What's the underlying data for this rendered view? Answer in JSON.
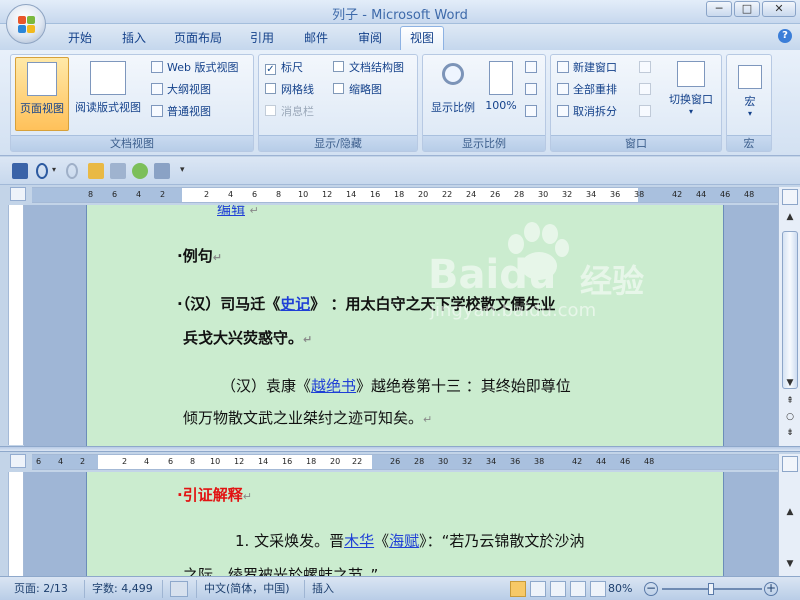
{
  "window": {
    "title": "列子 - Microsoft Word"
  },
  "tabs": [
    "开始",
    "插入",
    "页面布局",
    "引用",
    "邮件",
    "审阅",
    "视图"
  ],
  "active_tab": "视图",
  "ribbon": {
    "doc_views": {
      "label": "文档视图",
      "page_view": "页面视图",
      "reading_view": "阅读版式视图",
      "web_view": "Web 版式视图",
      "outline": "大纲视图",
      "draft": "普通视图"
    },
    "show_hide": {
      "label": "显示/隐藏",
      "ruler": "标尺",
      "doc_map": "文档结构图",
      "gridlines": "网格线",
      "thumbnails": "缩略图",
      "message_bar": "消息栏"
    },
    "zoom": {
      "label": "显示比例",
      "zoom": "显示比例",
      "hundred": "100%"
    },
    "window": {
      "label": "窗口",
      "new_window": "新建窗口",
      "arrange_all": "全部重排",
      "remove_split": "取消拆分",
      "switch": "切换窗口"
    },
    "macros": {
      "label": "宏",
      "macro": "宏"
    }
  },
  "ruler_top": [
    "8",
    "6",
    "4",
    "2",
    "2",
    "4",
    "6",
    "8",
    "10",
    "12",
    "14",
    "16",
    "18",
    "20",
    "22",
    "24",
    "26",
    "28",
    "30",
    "32",
    "34",
    "36",
    "38",
    "42",
    "44",
    "46",
    "48"
  ],
  "ruler_bottom": [
    "6",
    "4",
    "2",
    "2",
    "4",
    "6",
    "8",
    "10",
    "12",
    "14",
    "16",
    "18",
    "20",
    "22",
    "26",
    "28",
    "30",
    "32",
    "34",
    "36",
    "38",
    "42",
    "44",
    "46",
    "48"
  ],
  "top_pane": {
    "partial_link": "编辑",
    "heading": "例句",
    "line1_prefix": "（汉）司马迁《",
    "line1_link": "史记",
    "line1_suffix": "》 ：用太白守之天下学校散文儒失业",
    "line2": "兵戈大兴荧惑守。",
    "line3_prefix": "（汉）袁康《",
    "line3_link": "越绝书",
    "line3_suffix": "》越绝卷第十三 ：其终始即尊位",
    "line4": "倾万物散文武之业桀纣之迹可知矣。"
  },
  "bottom_pane": {
    "heading": "引证解释",
    "line1_prefix": "1. 文采焕发。晋",
    "line1_link1": "木华",
    "line1_mid": "《",
    "line1_link2": "海赋",
    "line1_suffix": "》：“若乃云锦散文於沙汭",
    "line2": "之际，绫罗被光於螺蚌之节。”"
  },
  "watermark": {
    "brand": "Baidu",
    "cn": "经验",
    "url": "jingyan.baidu.com"
  },
  "status": {
    "page": "页面: 2/13",
    "words": "字数: 4,499",
    "language": "中文(简体，中国)",
    "insert": "插入",
    "zoom": "80%"
  },
  "colors": {
    "page_bg": "#cbeccf",
    "link": "#1f3fd6",
    "heading_red": "#e21212"
  }
}
